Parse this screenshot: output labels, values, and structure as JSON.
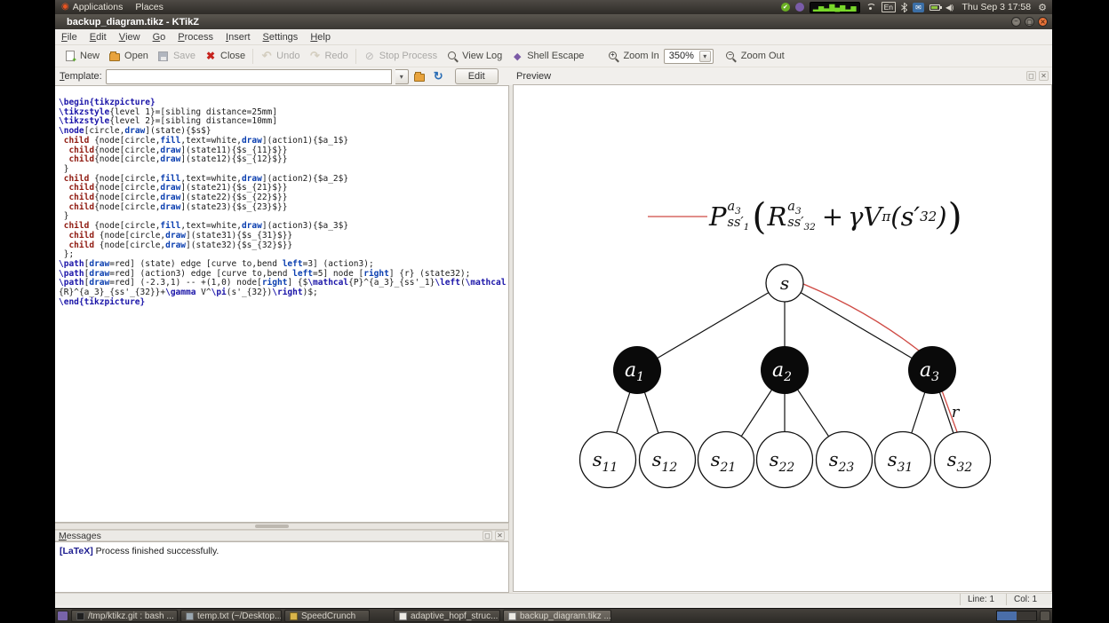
{
  "icons": {
    "ubuntu": "◉",
    "gear": "⚙",
    "envelope": "✉",
    "check": "✔",
    "dropdown": "▾",
    "reload": "↻",
    "undo": "↶",
    "redo": "↷",
    "close_round": "✖",
    "stop": "⊘",
    "shell": "◆",
    "float": "◻",
    "close_small": "✕",
    "eq_bars": "▂▅▃▇▄▆▂▅",
    "min": "–",
    "max": "▢",
    "speaker": "◀))"
  },
  "panel": {
    "applications": "Applications",
    "places": "Places",
    "keyboard": "En",
    "clock": "Thu Sep 3 17:58"
  },
  "titlebar": {
    "title": "backup_diagram.tikz - KTikZ"
  },
  "menubar": {
    "items": [
      "File",
      "Edit",
      "View",
      "Go",
      "Process",
      "Insert",
      "Settings",
      "Help"
    ]
  },
  "toolbar": {
    "new": "New",
    "open": "Open",
    "save": "Save",
    "close": "Close",
    "undo": "Undo",
    "redo": "Redo",
    "stop": "Stop Process",
    "viewlog": "View Log",
    "shell": "Shell Escape",
    "zoomin": "Zoom In",
    "zoom_value": "350%",
    "zoomout": "Zoom Out"
  },
  "template_row": {
    "label": "Template:",
    "value": "",
    "edit": "Edit"
  },
  "preview": {
    "title": "Preview"
  },
  "editor": {
    "lines": [
      "\\begin{tikzpicture}",
      "\\tikzstyle{level 1}=[sibling distance=25mm]",
      "\\tikzstyle{level 2}=[sibling distance=10mm]",
      "\\node[circle,draw](state){$s$}",
      " child {node[circle,fill,text=white,draw](action1){$a_1$}",
      "  child{node[circle,draw](state11){$s_{11}$}}",
      "  child{node[circle,draw](state12){$s_{12}$}}",
      " }",
      " child {node[circle,fill,text=white,draw](action2){$a_2$}",
      "  child{node[circle,draw](state21){$s_{21}$}}",
      "  child{node[circle,draw](state22){$s_{22}$}}",
      "  child{node[circle,draw](state23){$s_{23}$}}",
      " }",
      " child {node[circle,fill,text=white,draw](action3){$a_3$}",
      "  child {node[circle,draw](state31){$s_{31}$}}",
      "  child {node[circle,draw](state32){$s_{32}$}}",
      " };",
      "\\path[draw=red] (state) edge [curve to,bend left=3] (action3);",
      "\\path[draw=red] (action3) edge [curve to,bend left=5] node [right] {r} (state32);",
      "\\path[draw=red] (-2.3,1) -- +(1,0) node[right] {$\\mathcal{P}^{a_3}_{ss'_1}\\left(\\mathcal{R}^{a_3}_{ss'_{32}}+\\gamma V^\\pi(s'_{32})\\right)$;",
      "\\end{tikzpicture}"
    ]
  },
  "messages": {
    "title": "Messages",
    "prefix": "[LaTeX]",
    "text": " Process finished successfully."
  },
  "statusbar": {
    "line": "Line: 1",
    "col": "Col: 1"
  },
  "taskbar": {
    "items": [
      {
        "label": "/tmp/ktikz.git : bash ..."
      },
      {
        "label": "temp.txt (~/Desktop..."
      },
      {
        "label": "SpeedCrunch"
      },
      {
        "label": "adaptive_hopf_struc..."
      },
      {
        "label": "backup_diagram.tikz ..."
      }
    ]
  },
  "diagram": {
    "root": {
      "main": "s",
      "sub": ""
    },
    "actions": [
      {
        "main": "a",
        "sub": "1"
      },
      {
        "main": "a",
        "sub": "2"
      },
      {
        "main": "a",
        "sub": "3"
      }
    ],
    "leaves": [
      {
        "main": "s",
        "sub": "11"
      },
      {
        "main": "s",
        "sub": "12"
      },
      {
        "main": "s",
        "sub": "21"
      },
      {
        "main": "s",
        "sub": "22"
      },
      {
        "main": "s",
        "sub": "23"
      },
      {
        "main": "s",
        "sub": "31"
      },
      {
        "main": "s",
        "sub": "32"
      }
    ],
    "edge_label": "r",
    "colors": {
      "highlight": "#cf4a44",
      "node_fill": "#0a0a0a"
    }
  },
  "formula": {
    "p": "P",
    "sup_a": "a",
    "sup_idx": "3",
    "sub_base": "ss′",
    "sub_idx_p": "1",
    "sub_idx_r": "32",
    "open": "(",
    "r": "R",
    "plus": "+",
    "gammaV": "γV",
    "pi": "π",
    "tail": "(s′",
    "tail_idx": "32",
    "tail_close": ")",
    "big_close": ")"
  }
}
